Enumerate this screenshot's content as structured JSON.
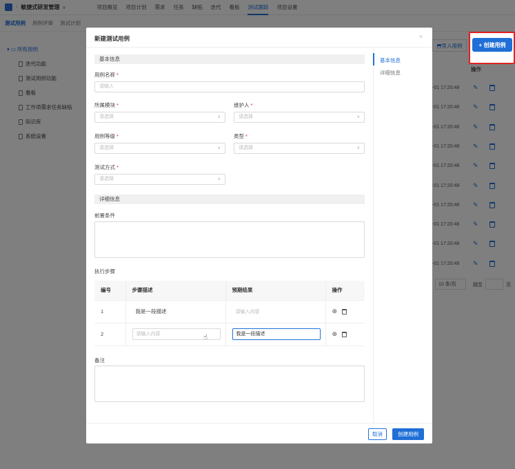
{
  "app": {
    "project_name": "敏捷式研发管理",
    "nav": [
      "项目概览",
      "项目计划",
      "需求",
      "任务",
      "缺陷",
      "迭代",
      "看板",
      "测试跟踪",
      "项目设置"
    ],
    "nav_active_index": 7
  },
  "subnav": [
    "测试用例",
    "用例评审",
    "测试计划"
  ],
  "sidebar": {
    "root": "所有用例",
    "items": [
      "迭代功能",
      "测试用例功能",
      "看板",
      "工作项需求任务缺陷",
      "知识库",
      "系统设置"
    ]
  },
  "toolbar": {
    "import_label": "导入用例",
    "create_label": "+ 创建用例"
  },
  "table": {
    "ops_header": "操作",
    "times": [
      "-01 17:20:48",
      "-01 17:20:48",
      "-01 17:20:48",
      "-01 17:20:48",
      "-01 17:20:48",
      "-01 17:20:48",
      "-01 17:20:48",
      "-01 17:20:48",
      "-01 17:20:48",
      "-01 17:20:48"
    ]
  },
  "pager": {
    "page_size": "10 条/页",
    "jump_label": "跳至",
    "page_label": "页"
  },
  "modal": {
    "title": "新建测试用例",
    "section_basic": "基本信息",
    "section_detail": "详细信息",
    "fields": {
      "name_label": "用例名称",
      "name_placeholder": "请输入",
      "module_label": "所属模块",
      "module_placeholder": "请选择",
      "maintainer_label": "维护人",
      "maintainer_placeholder": "请选择",
      "level_label": "用例等级",
      "level_placeholder": "请选择",
      "type_label": "类型",
      "type_placeholder": "请选择",
      "method_label": "测试方式",
      "method_placeholder": "请选择",
      "precondition_label": "前置条件",
      "steps_label": "执行步骤",
      "remark_label": "备注"
    },
    "steps_table": {
      "headers": [
        "编号",
        "步骤描述",
        "预期结果",
        "操作"
      ],
      "rows": [
        {
          "no": "1",
          "desc": "我是一段描述",
          "expected_placeholder": "请输入内容"
        },
        {
          "no": "2",
          "desc_placeholder": "请输入内容",
          "expected": "我是一段描述"
        }
      ]
    },
    "nav": [
      "基本信息",
      "详细信息"
    ],
    "cancel_label": "取消",
    "submit_label": "创建用例"
  }
}
